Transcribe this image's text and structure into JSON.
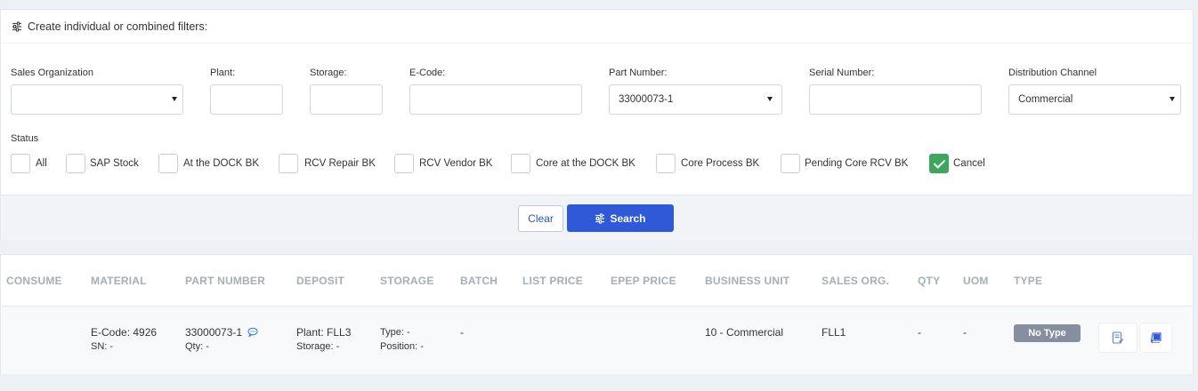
{
  "filters": {
    "header": "Create individual or combined filters:",
    "fields": {
      "sales_org": {
        "label": "Sales Organization",
        "value": ""
      },
      "plant": {
        "label": "Plant:",
        "value": ""
      },
      "storage": {
        "label": "Storage:",
        "value": ""
      },
      "ecode": {
        "label": "E-Code:",
        "value": ""
      },
      "part_number": {
        "label": "Part Number:",
        "value": "33000073-1"
      },
      "serial_number": {
        "label": "Serial Number:",
        "value": ""
      },
      "distribution_channel": {
        "label": "Distribution Channel",
        "value": "Commercial"
      }
    },
    "status": {
      "label": "Status",
      "options": [
        {
          "label": "All",
          "checked": false
        },
        {
          "label": "SAP Stock",
          "checked": false
        },
        {
          "label": "At the DOCK BK",
          "checked": false
        },
        {
          "label": "RCV Repair BK",
          "checked": false
        },
        {
          "label": "RCV Vendor BK",
          "checked": false
        },
        {
          "label": "Core at the DOCK BK",
          "checked": false
        },
        {
          "label": "Core Process BK",
          "checked": false
        },
        {
          "label": "Pending Core RCV BK",
          "checked": false
        },
        {
          "label": "Cancel",
          "checked": true
        }
      ]
    },
    "buttons": {
      "clear": "Clear",
      "search": "Search"
    }
  },
  "table": {
    "columns": [
      "CONSUME",
      "MATERIAL",
      "PART NUMBER",
      "DEPOSIT",
      "STORAGE",
      "BATCH",
      "LIST PRICE",
      "EPEP PRICE",
      "BUSINESS UNIT",
      "SALES ORG.",
      "QTY",
      "UOM",
      "TYPE"
    ],
    "rows": [
      {
        "ecode": "E-Code: 4926",
        "sn": "SN: -",
        "part_number": "33000073-1",
        "qty_sub": "Qty: -",
        "plant": "Plant: FLL3",
        "storage_sub": "Storage: -",
        "type_sub": "Type: -",
        "position_sub": "Position: -",
        "batch": "-",
        "business_unit": "10 - Commercial",
        "sales_org": "FLL1",
        "qty": "-",
        "uom": "-",
        "type_badge": "No Type"
      }
    ]
  },
  "colors": {
    "accent": "#2e59d9",
    "checked": "#3ea65f",
    "badge": "#868fa0"
  }
}
